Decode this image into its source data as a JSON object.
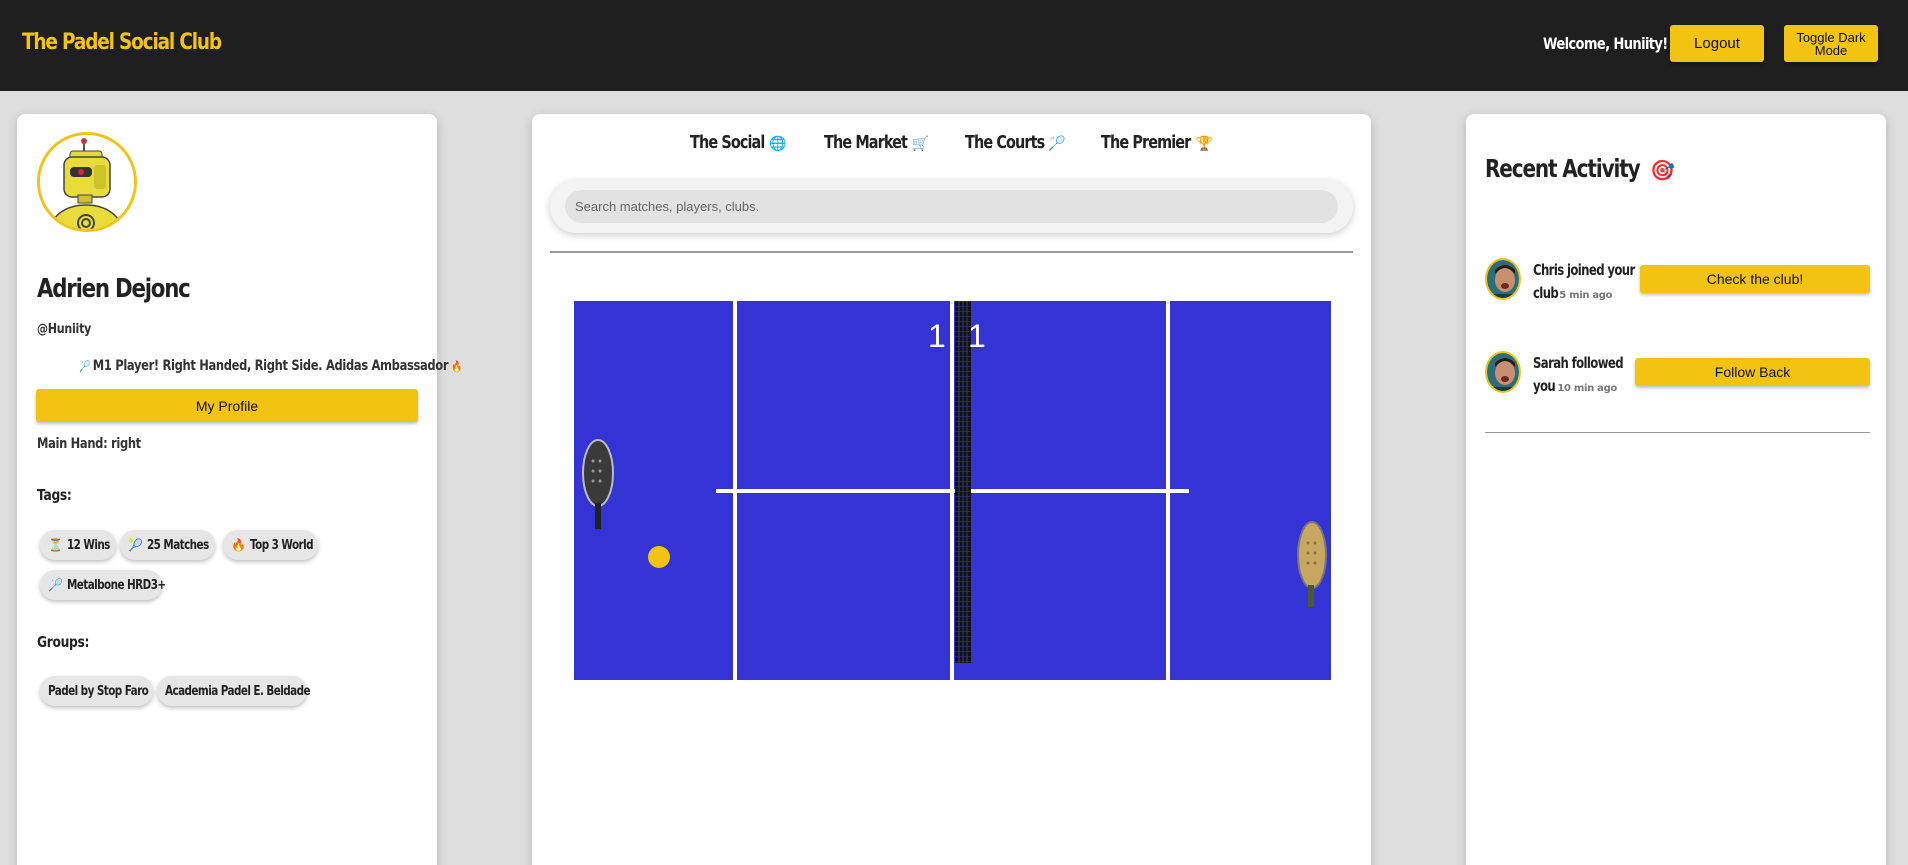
{
  "header": {
    "brand": "The Padel Social Club",
    "welcome": "Welcome, Huniity!",
    "logout_label": "Logout",
    "toggle_dark_label": "Toggle Dark Mode"
  },
  "profile": {
    "name": "Adrien Dejonc",
    "handle": "@Huniity",
    "bio": "M1 Player! Right Handed, Right Side. Adidas Ambassador",
    "bio_icon_left": "🏸",
    "bio_icon_right": "🔥",
    "profile_button": "My Profile",
    "main_hand": "Main Hand: right",
    "tags_label": "Tags:",
    "tags": [
      {
        "icon": "⏳",
        "label": "12 Wins"
      },
      {
        "icon": "🎾",
        "label": "25 Matches"
      },
      {
        "icon": "🔥",
        "label": "Top 3 World"
      },
      {
        "icon": "🏸",
        "label": "Metalbone HRD3+"
      }
    ],
    "groups_label": "Groups:",
    "groups": [
      "Padel by Stop Faro",
      "Academia Padel E. Beldade"
    ]
  },
  "nav": {
    "tabs": [
      {
        "label": "The Social",
        "icon": "🌐"
      },
      {
        "label": "The Market",
        "icon": "🛒"
      },
      {
        "label": "The Courts",
        "icon": "🏸"
      },
      {
        "label": "The Premier",
        "icon": "🏆"
      }
    ],
    "search_placeholder": "Search matches, players, clubs."
  },
  "game": {
    "score_left": "1",
    "score_right": "1",
    "court_color": "#3333d6",
    "ball_color": "#f2c311"
  },
  "activity": {
    "title": "Recent Activity",
    "title_icon": "🎯",
    "items": [
      {
        "line1": "Chris joined your",
        "line2": "club",
        "time": "5 min ago",
        "button": "Check the club!"
      },
      {
        "line1": "Sarah followed",
        "line2": "you",
        "time": "10 min ago",
        "button": "Follow Back"
      }
    ]
  },
  "colors": {
    "accent": "#f2c311",
    "header_bg": "#1f1f1f",
    "page_bg": "#dedede"
  }
}
